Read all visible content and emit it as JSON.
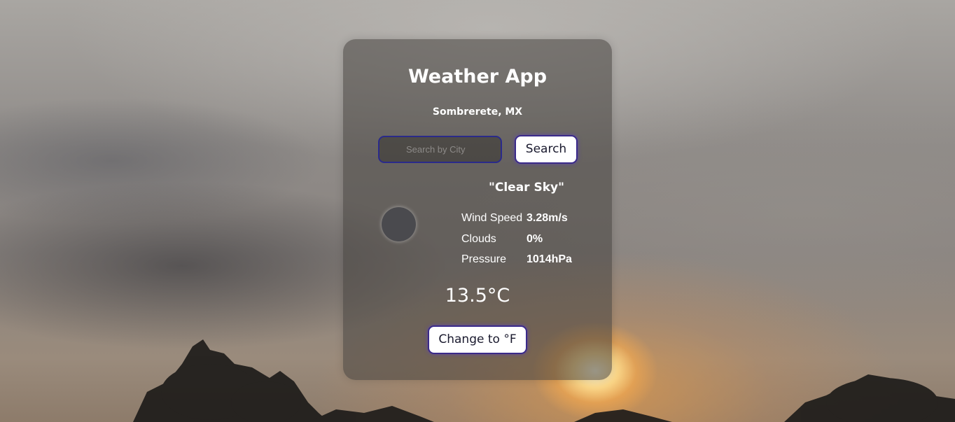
{
  "app": {
    "title": "Weather App"
  },
  "location": "Sombrerete, MX",
  "search": {
    "placeholder": "Search by City",
    "value": "",
    "button_label": "Search"
  },
  "weather": {
    "description": "\"Clear Sky\"",
    "icon": "weather-condition-icon",
    "stats": [
      {
        "label": "Wind Speed",
        "value": "3.28m/s"
      },
      {
        "label": "Clouds",
        "value": "0%"
      },
      {
        "label": "Pressure",
        "value": "1014hPa"
      }
    ],
    "temperature": "13.5°C"
  },
  "unit_toggle": {
    "label": "Change to °F"
  },
  "colors": {
    "button_border": "#3a2a8a",
    "input_border": "#2a2a8a",
    "card_background": "rgba(70,66,62,0.55)"
  }
}
